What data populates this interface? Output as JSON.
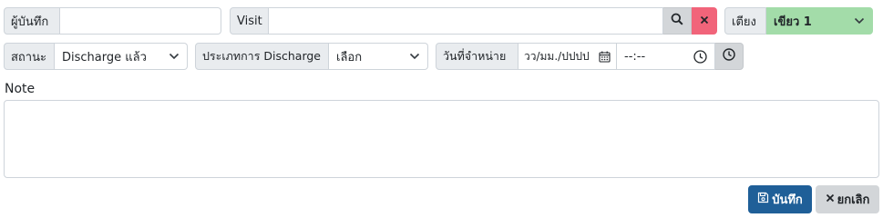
{
  "row1": {
    "recorder_label": "ผู้บันทึก",
    "recorder_value": "",
    "visit_label": "Visit",
    "visit_value": "",
    "bed_label": "เตียง",
    "bed_value": "เขียว 1"
  },
  "row2": {
    "status_label": "สถานะ",
    "status_value": "Discharge แล้ว",
    "discharge_type_label": "ประเภทการ Discharge",
    "discharge_type_value": "เลือก",
    "discharge_date_label": "วันที่จำหน่าย",
    "date_placeholder": "วว/มม./ปปปป",
    "time_placeholder": "--:--"
  },
  "note": {
    "label": "Note",
    "value": ""
  },
  "actions": {
    "save_label": "บันทึก",
    "cancel_label": "ยกเลิก"
  },
  "colors": {
    "bed_select_bg": "#a3dca9",
    "clear_button_bg": "#f1647a",
    "save_button_bg": "#1f5f98",
    "cancel_button_bg": "#d3d6d9"
  }
}
